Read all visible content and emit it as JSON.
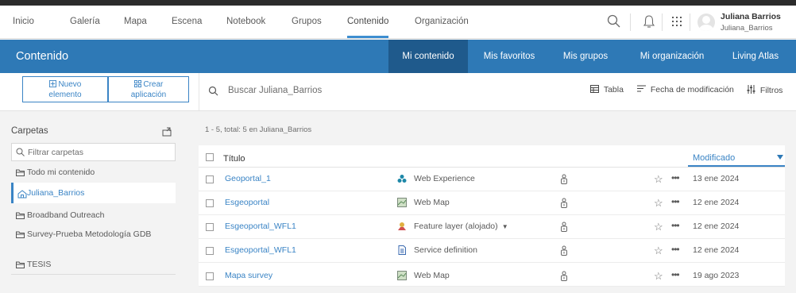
{
  "topnav": {
    "items": [
      "Inicio",
      "Galería",
      "Mapa",
      "Escena",
      "Notebook",
      "Grupos",
      "Contenido",
      "Organización"
    ],
    "active_item": "Contenido",
    "user": {
      "name": "Juliana Barrios",
      "login": "Juliana_Barrios"
    }
  },
  "bluebar": {
    "title": "Contenido",
    "tabs": [
      "Mi contenido",
      "Mis favoritos",
      "Mis grupos",
      "Mi organización",
      "Living Atlas"
    ],
    "active_tab": "Mi contenido"
  },
  "toolbar": {
    "new_item": [
      "Nuevo",
      "elemento"
    ],
    "create_app": [
      "Crear",
      "aplicación"
    ],
    "search_placeholder": "Buscar Juliana_Barrios",
    "view_label": "Tabla",
    "sort_label": "Fecha de modificación",
    "filters_label": "Filtros"
  },
  "sidebar": {
    "title": "Carpetas",
    "filter_placeholder": "Filtrar carpetas",
    "folders": [
      {
        "label": "Todo mi contenido",
        "active": false
      },
      {
        "label": "Juliana_Barrios",
        "active": true
      },
      {
        "label": "Broadband Outreach",
        "active": false
      },
      {
        "label": "Survey-Prueba Metodología GDB",
        "active": false
      },
      {
        "label": "TESIS",
        "active": false
      }
    ]
  },
  "results": {
    "count_text": "1 - 5, total: 5 en Juliana_Barrios",
    "col_title": "Título",
    "col_modified": "Modificado",
    "rows": [
      {
        "title": "Geoportal_1",
        "type": "Web Experience",
        "type_icon": "web-experience-icon",
        "modified": "13 ene 2024"
      },
      {
        "title": "Esgeoportal",
        "type": "Web Map",
        "type_icon": "web-map-icon",
        "modified": "12 ene 2024"
      },
      {
        "title": "Esgeoportal_WFL1",
        "type": "Feature layer (alojado)",
        "type_icon": "feature-layer-icon",
        "modified": "12 ene 2024"
      },
      {
        "title": "Esgeoportal_WFL1",
        "type": "Service definition",
        "type_icon": "service-definition-icon",
        "modified": "12 ene 2024"
      },
      {
        "title": "Mapa survey",
        "type": "Web Map",
        "type_icon": "web-map-icon",
        "modified": "19 ago 2023"
      }
    ]
  },
  "colors": {
    "accent": "#2e79b6",
    "accent_dark": "#1f5a8c",
    "link": "#3a84c5"
  }
}
